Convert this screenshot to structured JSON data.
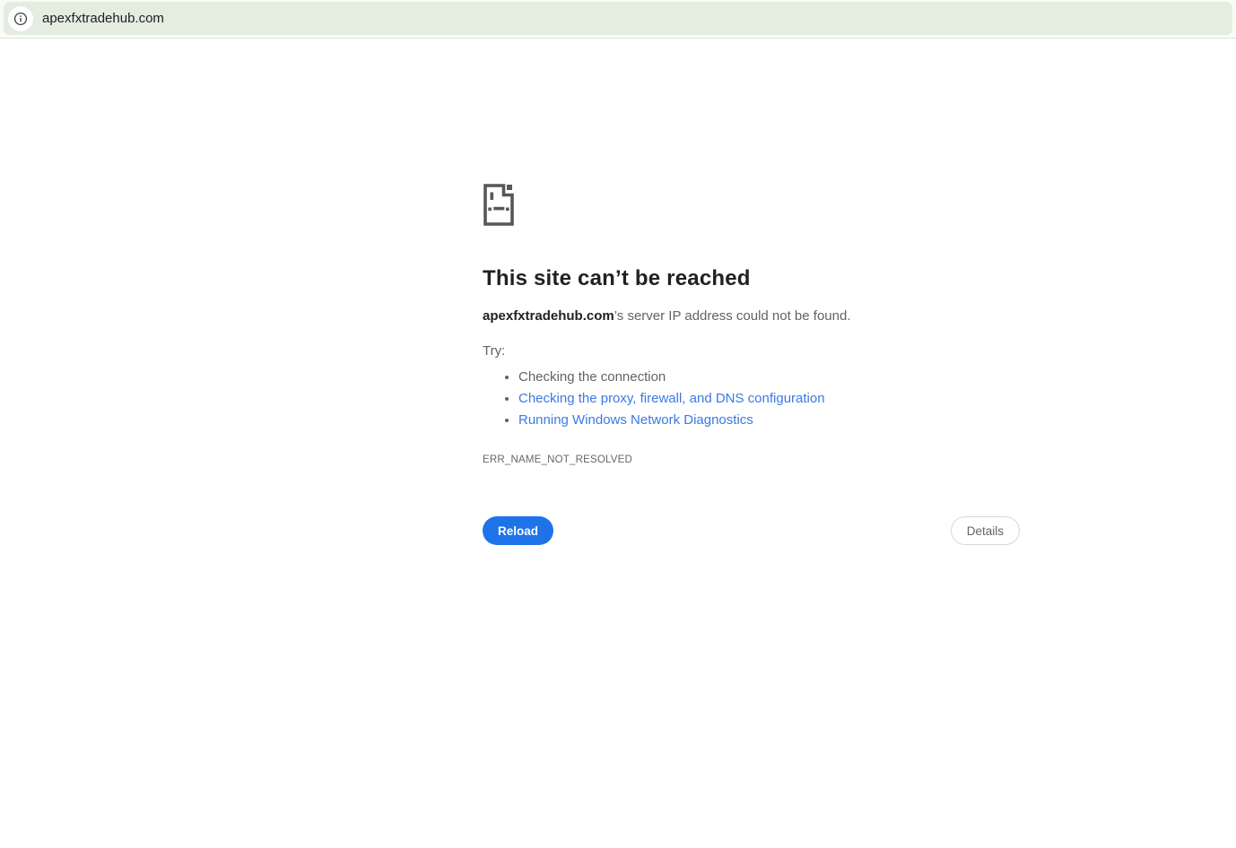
{
  "browser": {
    "address_bar": {
      "url": "apexfxtradehub.com",
      "info_icon": "page-info-circle-i"
    }
  },
  "error_page": {
    "title": "This site can’t be reached",
    "domain": "apexfxtradehub.com",
    "message_suffix": "’s server IP address could not be found.",
    "try_label": "Try:",
    "suggestions": [
      {
        "label": "Checking the connection",
        "is_link": false
      },
      {
        "label": "Checking the proxy, firewall, and DNS configuration",
        "is_link": true
      },
      {
        "label": "Running Windows Network Diagnostics",
        "is_link": true
      }
    ],
    "error_code": "ERR_NAME_NOT_RESOLVED",
    "buttons": {
      "reload": "Reload",
      "details": "Details"
    },
    "icon": "sad-file-document"
  },
  "colors": {
    "toolbar_bg": "#f9fbf6",
    "omnibox_green": "#e5ece0",
    "reload_button_blue": "#1f73e8",
    "link_blue": "#3b78e7",
    "heading_text": "#202124",
    "body_gray": "#5f6368",
    "icon_gray": "#575757"
  }
}
